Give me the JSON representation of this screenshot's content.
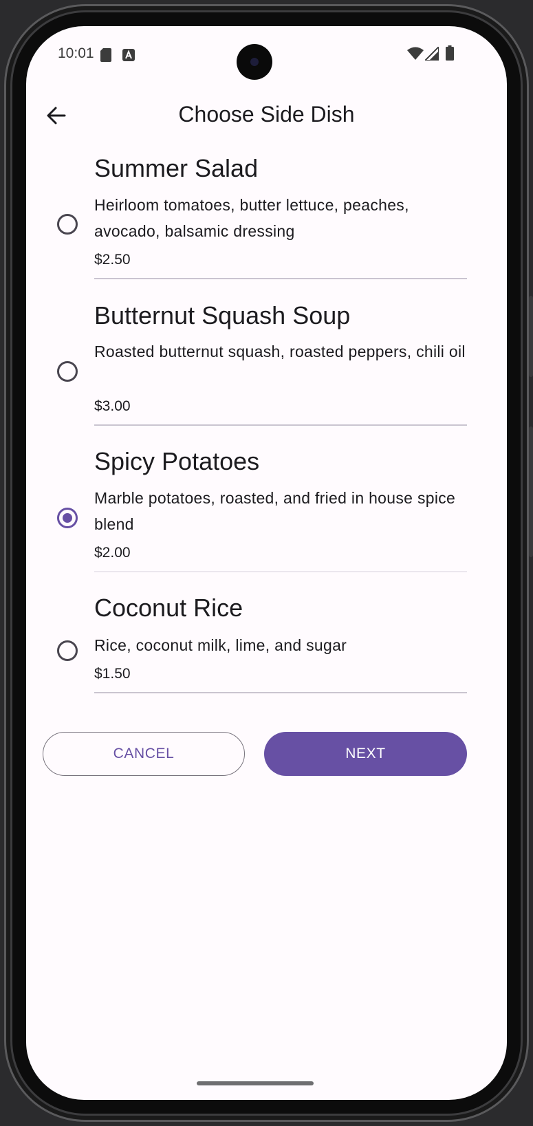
{
  "status_bar": {
    "time": "10:01",
    "icons": [
      "sd-card-icon",
      "a-notification-icon",
      "wifi-icon",
      "signal-icon",
      "battery-icon"
    ]
  },
  "header": {
    "title": "Choose Side Dish",
    "back_icon": "arrow-back-icon"
  },
  "options": [
    {
      "name": "Summer Salad",
      "description": "Heirloom tomatoes, butter lettuce, peaches, avocado, balsamic dressing",
      "price": "$2.50",
      "selected": false
    },
    {
      "name": "Butternut Squash Soup",
      "description": "Roasted butternut squash, roasted peppers, chili oil",
      "price": "$3.00",
      "selected": false
    },
    {
      "name": "Spicy Potatoes",
      "description": "Marble potatoes, roasted, and fried in house spice blend",
      "price": "$2.00",
      "selected": true
    },
    {
      "name": "Coconut Rice",
      "description": "Rice, coconut milk, lime, and sugar",
      "price": "$1.50",
      "selected": false
    }
  ],
  "actions": {
    "cancel_label": "CANCEL",
    "next_label": "NEXT"
  },
  "colors": {
    "primary": "#6750a4",
    "background": "#fffbfe",
    "on_surface": "#1c1b1f",
    "outline": "#79747e"
  }
}
